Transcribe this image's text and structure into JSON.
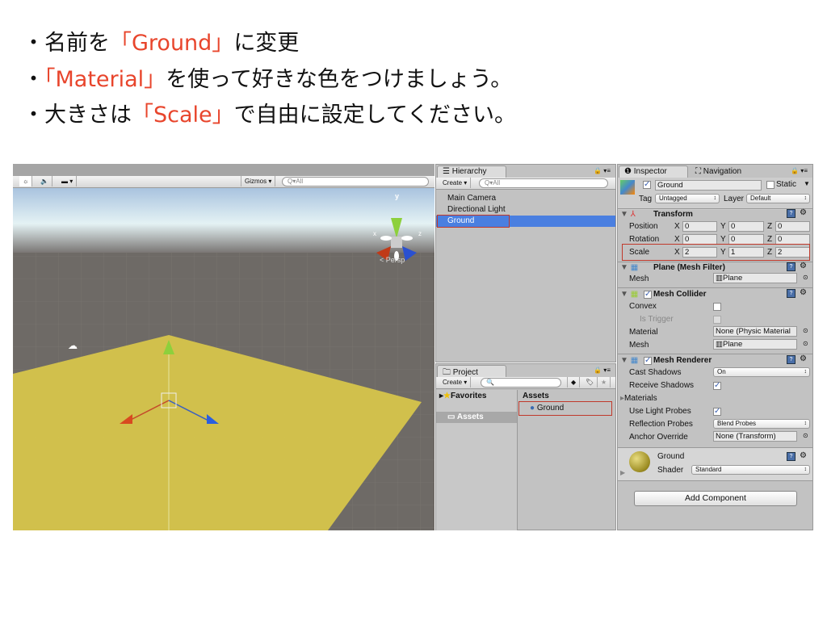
{
  "bullets": [
    {
      "dot": "・",
      "pre": "名前を",
      "hl": "「Ground」",
      "post": "に変更"
    },
    {
      "dot": "・",
      "pre": "",
      "hl": "「Material」",
      "post": "を使って好きな色をつけましょう。"
    },
    {
      "dot": "・",
      "pre": "大きさは",
      "hl": "「Scale」",
      "post": "で自由に設定してください。"
    }
  ],
  "scene": {
    "gizmos": "Gizmos ▾",
    "search": "Q▾All",
    "axis_y": "y",
    "axis_x": "x",
    "axis_z": "z",
    "persp": "< Persp",
    "colors": {
      "plane": "#d9c84a",
      "sky": "#a9c3df",
      "ground": "#6e6a66"
    }
  },
  "hierarchy": {
    "tab": "☰ Hierarchy",
    "create": "Create ▾",
    "search": "Q▾All",
    "items": [
      "Main Camera",
      "Directional Light",
      "Ground"
    ],
    "selected": "Ground",
    "selected_color": "#4a7fe0"
  },
  "project": {
    "tab": "Project",
    "create": "Create ▾",
    "favorites": "Favorites",
    "assets": "Assets",
    "assets_header": "Assets",
    "items": [
      "Ground"
    ]
  },
  "inspector": {
    "tab": "Inspector",
    "nav_tab": "Navigation",
    "name": "Ground",
    "static": "Static",
    "tag_label": "Tag",
    "tag": "Untagged",
    "layer_label": "Layer",
    "layer": "Default",
    "transform": {
      "title": "Transform",
      "rows": [
        {
          "label": "Position",
          "x": "0",
          "y": "0",
          "z": "0"
        },
        {
          "label": "Rotation",
          "x": "0",
          "y": "0",
          "z": "0"
        },
        {
          "label": "Scale",
          "x": "2",
          "y": "1",
          "z": "2"
        }
      ]
    },
    "mesh_filter": {
      "title": "Plane (Mesh Filter)",
      "mesh_label": "Mesh",
      "mesh": "Plane"
    },
    "mesh_collider": {
      "title": "Mesh Collider",
      "convex": "Convex",
      "is_trigger": "Is Trigger",
      "material_label": "Material",
      "material": "None (Physic Material",
      "mesh_label": "Mesh",
      "mesh": "Plane"
    },
    "mesh_renderer": {
      "title": "Mesh Renderer",
      "cast_shadows": "Cast Shadows",
      "cast_value": "On",
      "receive_shadows": "Receive Shadows",
      "materials": "Materials",
      "light_probes": "Use Light Probes",
      "reflection_probes": "Reflection Probes",
      "reflection_value": "Blend Probes",
      "anchor_override": "Anchor Override",
      "anchor_value": "None (Transform)"
    },
    "material": {
      "name": "Ground",
      "shader_label": "Shader",
      "shader": "Standard"
    },
    "add_component": "Add Component"
  }
}
